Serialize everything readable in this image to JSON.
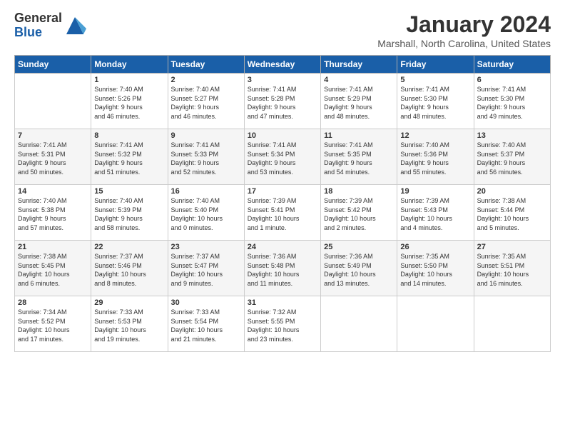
{
  "header": {
    "logo_general": "General",
    "logo_blue": "Blue",
    "title": "January 2024",
    "location": "Marshall, North Carolina, United States"
  },
  "days_of_week": [
    "Sunday",
    "Monday",
    "Tuesday",
    "Wednesday",
    "Thursday",
    "Friday",
    "Saturday"
  ],
  "weeks": [
    [
      {
        "num": "",
        "info": ""
      },
      {
        "num": "1",
        "info": "Sunrise: 7:40 AM\nSunset: 5:26 PM\nDaylight: 9 hours\nand 46 minutes."
      },
      {
        "num": "2",
        "info": "Sunrise: 7:40 AM\nSunset: 5:27 PM\nDaylight: 9 hours\nand 46 minutes."
      },
      {
        "num": "3",
        "info": "Sunrise: 7:41 AM\nSunset: 5:28 PM\nDaylight: 9 hours\nand 47 minutes."
      },
      {
        "num": "4",
        "info": "Sunrise: 7:41 AM\nSunset: 5:29 PM\nDaylight: 9 hours\nand 48 minutes."
      },
      {
        "num": "5",
        "info": "Sunrise: 7:41 AM\nSunset: 5:30 PM\nDaylight: 9 hours\nand 48 minutes."
      },
      {
        "num": "6",
        "info": "Sunrise: 7:41 AM\nSunset: 5:30 PM\nDaylight: 9 hours\nand 49 minutes."
      }
    ],
    [
      {
        "num": "7",
        "info": "Sunrise: 7:41 AM\nSunset: 5:31 PM\nDaylight: 9 hours\nand 50 minutes."
      },
      {
        "num": "8",
        "info": "Sunrise: 7:41 AM\nSunset: 5:32 PM\nDaylight: 9 hours\nand 51 minutes."
      },
      {
        "num": "9",
        "info": "Sunrise: 7:41 AM\nSunset: 5:33 PM\nDaylight: 9 hours\nand 52 minutes."
      },
      {
        "num": "10",
        "info": "Sunrise: 7:41 AM\nSunset: 5:34 PM\nDaylight: 9 hours\nand 53 minutes."
      },
      {
        "num": "11",
        "info": "Sunrise: 7:41 AM\nSunset: 5:35 PM\nDaylight: 9 hours\nand 54 minutes."
      },
      {
        "num": "12",
        "info": "Sunrise: 7:40 AM\nSunset: 5:36 PM\nDaylight: 9 hours\nand 55 minutes."
      },
      {
        "num": "13",
        "info": "Sunrise: 7:40 AM\nSunset: 5:37 PM\nDaylight: 9 hours\nand 56 minutes."
      }
    ],
    [
      {
        "num": "14",
        "info": "Sunrise: 7:40 AM\nSunset: 5:38 PM\nDaylight: 9 hours\nand 57 minutes."
      },
      {
        "num": "15",
        "info": "Sunrise: 7:40 AM\nSunset: 5:39 PM\nDaylight: 9 hours\nand 58 minutes."
      },
      {
        "num": "16",
        "info": "Sunrise: 7:40 AM\nSunset: 5:40 PM\nDaylight: 10 hours\nand 0 minutes."
      },
      {
        "num": "17",
        "info": "Sunrise: 7:39 AM\nSunset: 5:41 PM\nDaylight: 10 hours\nand 1 minute."
      },
      {
        "num": "18",
        "info": "Sunrise: 7:39 AM\nSunset: 5:42 PM\nDaylight: 10 hours\nand 2 minutes."
      },
      {
        "num": "19",
        "info": "Sunrise: 7:39 AM\nSunset: 5:43 PM\nDaylight: 10 hours\nand 4 minutes."
      },
      {
        "num": "20",
        "info": "Sunrise: 7:38 AM\nSunset: 5:44 PM\nDaylight: 10 hours\nand 5 minutes."
      }
    ],
    [
      {
        "num": "21",
        "info": "Sunrise: 7:38 AM\nSunset: 5:45 PM\nDaylight: 10 hours\nand 6 minutes."
      },
      {
        "num": "22",
        "info": "Sunrise: 7:37 AM\nSunset: 5:46 PM\nDaylight: 10 hours\nand 8 minutes."
      },
      {
        "num": "23",
        "info": "Sunrise: 7:37 AM\nSunset: 5:47 PM\nDaylight: 10 hours\nand 9 minutes."
      },
      {
        "num": "24",
        "info": "Sunrise: 7:36 AM\nSunset: 5:48 PM\nDaylight: 10 hours\nand 11 minutes."
      },
      {
        "num": "25",
        "info": "Sunrise: 7:36 AM\nSunset: 5:49 PM\nDaylight: 10 hours\nand 13 minutes."
      },
      {
        "num": "26",
        "info": "Sunrise: 7:35 AM\nSunset: 5:50 PM\nDaylight: 10 hours\nand 14 minutes."
      },
      {
        "num": "27",
        "info": "Sunrise: 7:35 AM\nSunset: 5:51 PM\nDaylight: 10 hours\nand 16 minutes."
      }
    ],
    [
      {
        "num": "28",
        "info": "Sunrise: 7:34 AM\nSunset: 5:52 PM\nDaylight: 10 hours\nand 17 minutes."
      },
      {
        "num": "29",
        "info": "Sunrise: 7:33 AM\nSunset: 5:53 PM\nDaylight: 10 hours\nand 19 minutes."
      },
      {
        "num": "30",
        "info": "Sunrise: 7:33 AM\nSunset: 5:54 PM\nDaylight: 10 hours\nand 21 minutes."
      },
      {
        "num": "31",
        "info": "Sunrise: 7:32 AM\nSunset: 5:55 PM\nDaylight: 10 hours\nand 23 minutes."
      },
      {
        "num": "",
        "info": ""
      },
      {
        "num": "",
        "info": ""
      },
      {
        "num": "",
        "info": ""
      }
    ]
  ]
}
